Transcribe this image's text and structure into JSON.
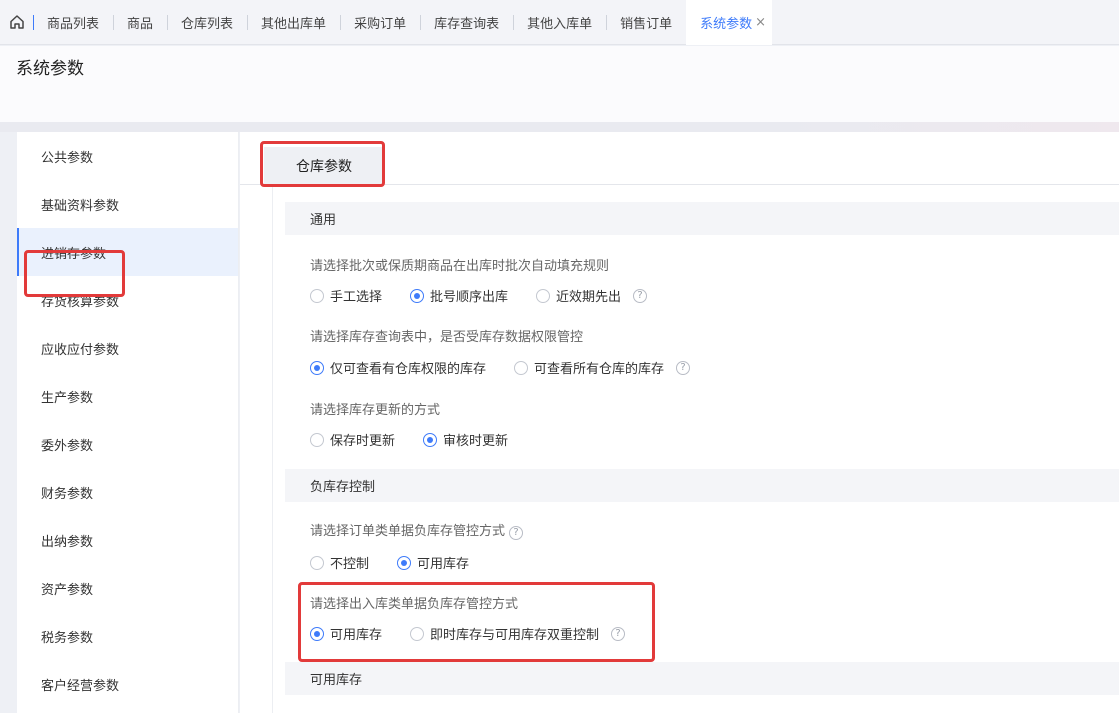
{
  "tabs": {
    "home_icon": "home-icon",
    "items": [
      "商品列表",
      "商品",
      "仓库列表",
      "其他出库单",
      "采购订单",
      "库存查询表",
      "其他入库单",
      "销售订单"
    ],
    "active": "系统参数",
    "close": "×"
  },
  "page": {
    "title": "系统参数"
  },
  "sidebar": {
    "items": [
      "公共参数",
      "基础资料参数",
      "进销存参数",
      "存货核算参数",
      "应收应付参数",
      "生产参数",
      "委外参数",
      "财务参数",
      "出纳参数",
      "资产参数",
      "税务参数",
      "客户经营参数"
    ],
    "active_index": 2
  },
  "section": {
    "title": "仓库参数"
  },
  "groups": {
    "general": "通用",
    "negative": "负库存控制",
    "available": "可用库存"
  },
  "settings": {
    "batch_rule": {
      "question": "请选择批次或保质期商品在出库时批次自动填充规则",
      "options": [
        "手工选择",
        "批号顺序出库",
        "近效期先出"
      ],
      "selected": "批号顺序出库"
    },
    "inventory_permission": {
      "question": "请选择库存查询表中，是否受库存数据权限管控",
      "options": [
        "仅可查看有仓库权限的库存",
        "可查看所有仓库的库存"
      ],
      "selected": "仅可查看有仓库权限的库存"
    },
    "inventory_update": {
      "question": "请选择库存更新的方式",
      "options": [
        "保存时更新",
        "审核时更新"
      ],
      "selected": "审核时更新"
    },
    "order_negative": {
      "question": "请选择订单类单据负库存管控方式",
      "options": [
        "不控制",
        "可用库存"
      ],
      "selected": "可用库存"
    },
    "outbound_negative": {
      "question": "请选择出入库类单据负库存管控方式",
      "options": [
        "可用库存",
        "即时库存与可用库存双重控制"
      ],
      "selected": "可用库存"
    }
  },
  "help_icon": "?",
  "colors": {
    "accent": "#3e7bfa",
    "highlight": "#e23a3a"
  }
}
